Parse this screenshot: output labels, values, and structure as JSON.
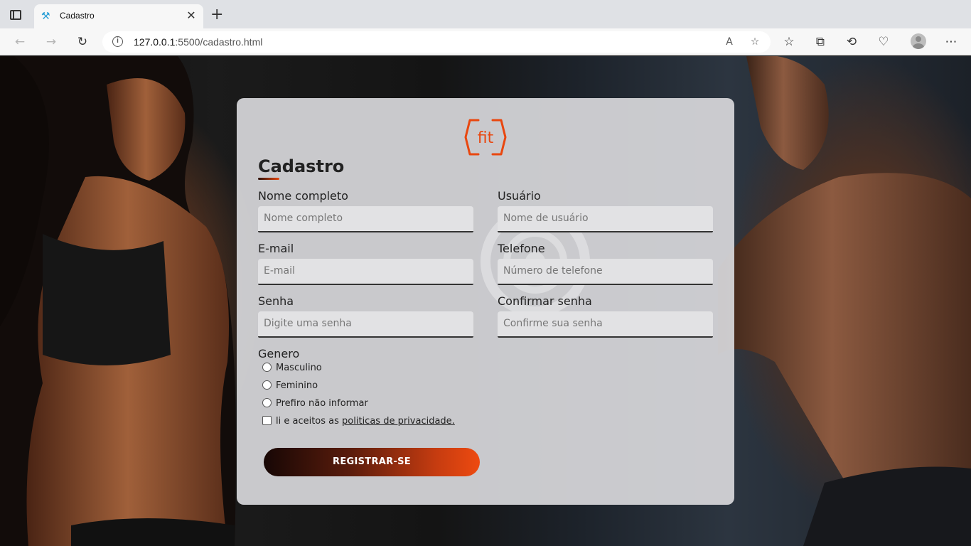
{
  "browser": {
    "tab_title": "Cadastro",
    "url_host": "127.0.0.1",
    "url_path": ":5500/cadastro.html",
    "tab_close": "✕",
    "new_tab": "+"
  },
  "form": {
    "title": "Cadastro",
    "fields": [
      {
        "label": "Nome completo",
        "placeholder": "Nome completo"
      },
      {
        "label": "Usuário",
        "placeholder": "Nome de usuário"
      },
      {
        "label": "E-mail",
        "placeholder": "E-mail"
      },
      {
        "label": "Telefone",
        "placeholder": "Número de telefone"
      },
      {
        "label": "Senha",
        "placeholder": "Digite uma senha"
      },
      {
        "label": "Confirmar senha",
        "placeholder": "Confirme sua senha"
      }
    ],
    "gender": {
      "label": "Genero",
      "options": [
        "Masculino",
        "Feminino",
        "Prefiro não informar"
      ]
    },
    "terms_prefix": "li e aceitos as ",
    "terms_link": "politicas de privacidade.",
    "submit": "REGISTRAR-SE"
  },
  "colors": {
    "accent": "#e9470f",
    "accent_dark": "#170705",
    "card": "#d7d7da"
  },
  "logo": {
    "text": "fit"
  }
}
